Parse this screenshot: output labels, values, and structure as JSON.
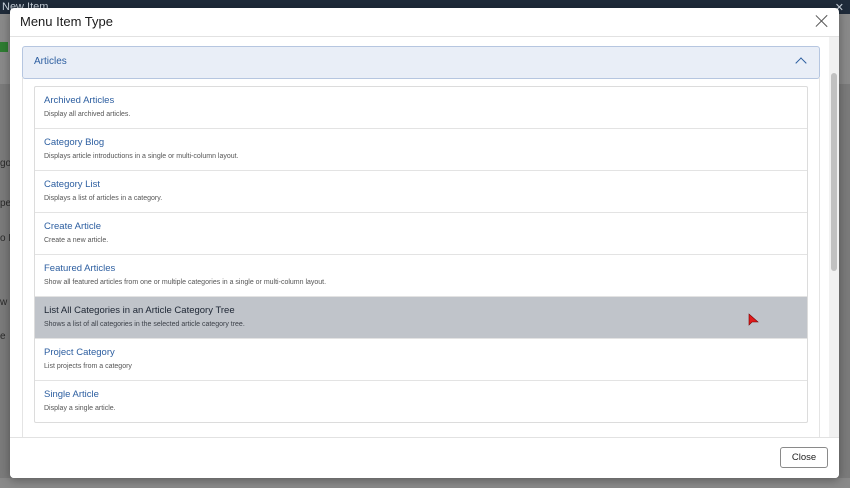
{
  "background": {
    "topbar_title": "New Item",
    "topbar_right": "✕",
    "side_fragments": [
      "go",
      "pe",
      "o L",
      "w",
      "e"
    ]
  },
  "modal": {
    "title": "Menu Item Type",
    "close_button_label": "Close"
  },
  "accordion": {
    "title": "Articles",
    "items": [
      {
        "title": "Archived Articles",
        "description": "Display all archived articles."
      },
      {
        "title": "Category Blog",
        "description": "Displays article introductions in a single or multi-column layout."
      },
      {
        "title": "Category List",
        "description": "Displays a list of articles in a category."
      },
      {
        "title": "Create Article",
        "description": "Create a new article."
      },
      {
        "title": "Featured Articles",
        "description": "Show all featured articles from one or multiple categories in a single or multi-column layout."
      },
      {
        "title": "List All Categories in an Article Category Tree",
        "description": "Shows a list of all categories in the selected article category tree."
      },
      {
        "title": "Project Category",
        "description": "List projects from a category"
      },
      {
        "title": "Single Article",
        "description": "Display a single article."
      }
    ]
  },
  "colors": {
    "accent": "#2c5ea0",
    "selected_row": "#c0c4ca",
    "accordion_header_bg": "#e9eef7"
  }
}
